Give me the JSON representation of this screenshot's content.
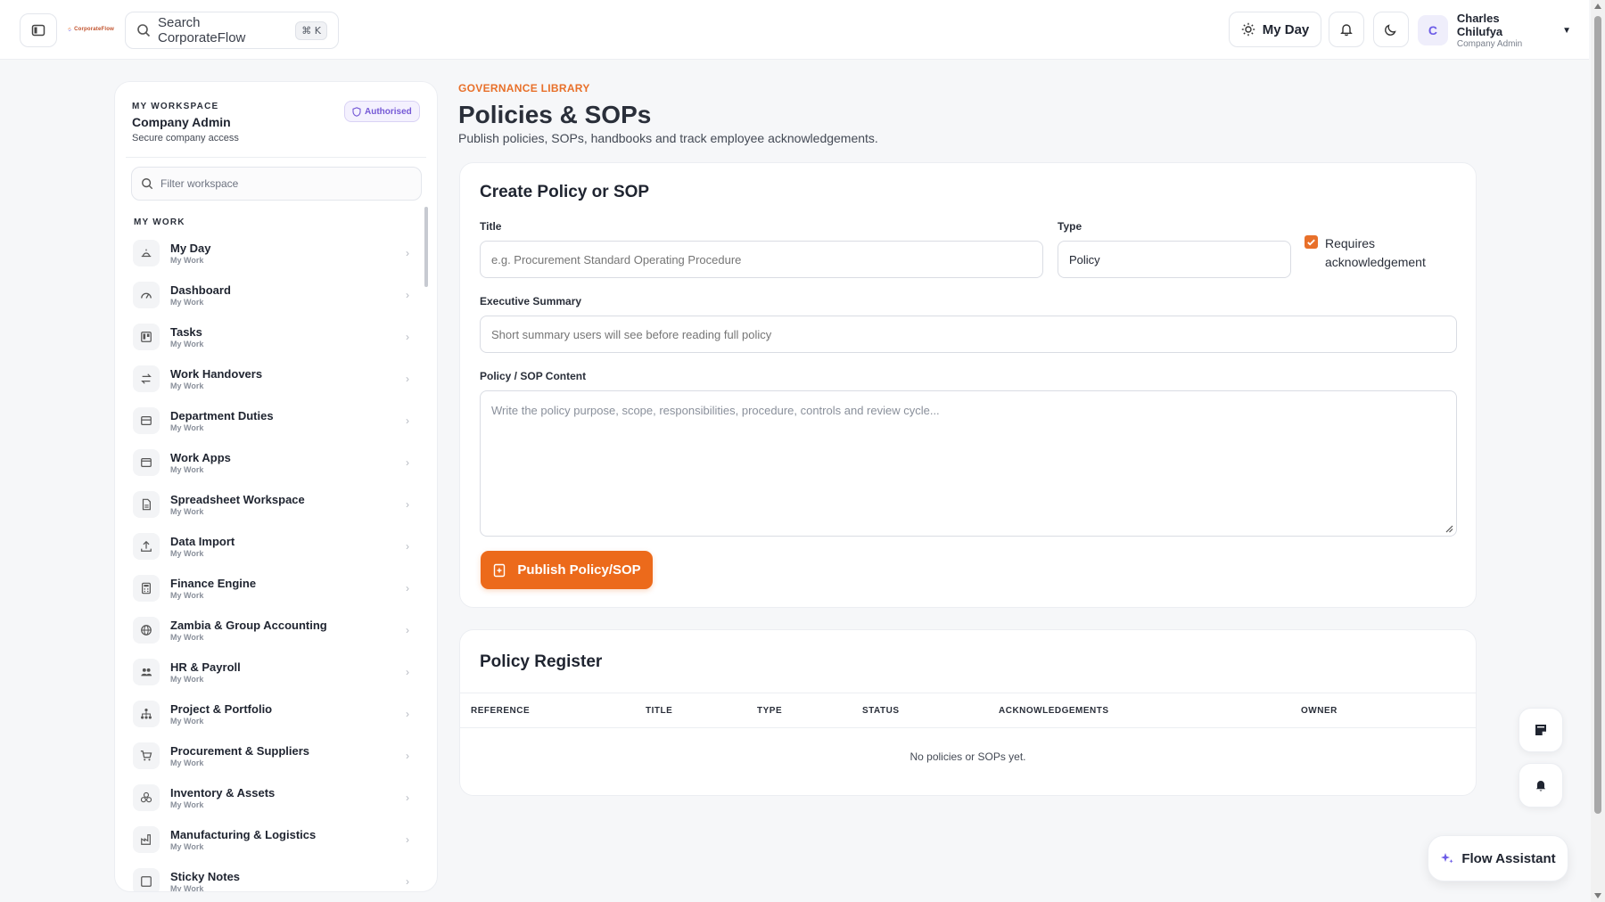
{
  "topbar": {
    "logo_text": "CorporateFlow",
    "search_label": "Search CorporateFlow",
    "search_shortcut": "⌘ K",
    "myday_label": "My Day",
    "user": {
      "initial": "C",
      "name": "Charles Chilufya",
      "role": "Company Admin"
    }
  },
  "sidebar": {
    "eyebrow": "MY WORKSPACE",
    "workspace_name": "Company Admin",
    "workspace_sub": "Secure company access",
    "badge": "Authorised",
    "filter_placeholder": "Filter workspace",
    "section": "MY WORK",
    "items": [
      {
        "label": "My Day",
        "sub": "My Work",
        "icon": "sun-icon"
      },
      {
        "label": "Dashboard",
        "sub": "My Work",
        "icon": "gauge-icon"
      },
      {
        "label": "Tasks",
        "sub": "My Work",
        "icon": "kanban-icon"
      },
      {
        "label": "Work Handovers",
        "sub": "My Work",
        "icon": "swap-icon"
      },
      {
        "label": "Department Duties",
        "sub": "My Work",
        "icon": "inbox-icon"
      },
      {
        "label": "Work Apps",
        "sub": "My Work",
        "icon": "app-window-icon"
      },
      {
        "label": "Spreadsheet Workspace",
        "sub": "My Work",
        "icon": "sheet-icon"
      },
      {
        "label": "Data Import",
        "sub": "My Work",
        "icon": "upload-icon"
      },
      {
        "label": "Finance Engine",
        "sub": "My Work",
        "icon": "calculator-icon"
      },
      {
        "label": "Zambia & Group Accounting",
        "sub": "My Work",
        "icon": "globe-icon"
      },
      {
        "label": "HR & Payroll",
        "sub": "My Work",
        "icon": "users-icon"
      },
      {
        "label": "Project & Portfolio",
        "sub": "My Work",
        "icon": "hierarchy-icon"
      },
      {
        "label": "Procurement & Suppliers",
        "sub": "My Work",
        "icon": "cart-icon"
      },
      {
        "label": "Inventory & Assets",
        "sub": "My Work",
        "icon": "boxes-icon"
      },
      {
        "label": "Manufacturing & Logistics",
        "sub": "My Work",
        "icon": "factory-icon"
      },
      {
        "label": "Sticky Notes",
        "sub": "My Work",
        "icon": "note-icon"
      }
    ]
  },
  "page": {
    "eyebrow": "GOVERNANCE LIBRARY",
    "title": "Policies & SOPs",
    "subtitle": "Publish policies, SOPs, handbooks and track employee acknowledgements."
  },
  "create": {
    "title": "Create Policy or SOP",
    "title_label": "Title",
    "title_placeholder": "e.g. Procurement Standard Operating Procedure",
    "type_label": "Type",
    "type_value": "Policy",
    "ack_label": "Requires acknowledgement",
    "ack_checked": true,
    "summary_label": "Executive Summary",
    "summary_placeholder": "Short summary users will see before reading full policy",
    "content_label": "Policy / SOP Content",
    "content_placeholder": "Write the policy purpose, scope, responsibilities, procedure, controls and review cycle...",
    "publish_label": "Publish Policy/SOP"
  },
  "register": {
    "title": "Policy Register",
    "columns": [
      "REFERENCE",
      "TITLE",
      "TYPE",
      "STATUS",
      "ACKNOWLEDGEMENTS",
      "OWNER"
    ],
    "empty_text": "No policies or SOPs yet."
  },
  "assistant": {
    "label": "Flow Assistant"
  },
  "colors": {
    "accent": "#ec6a1b",
    "eyebrow": "#e8702a",
    "badge": "#7559d6"
  }
}
